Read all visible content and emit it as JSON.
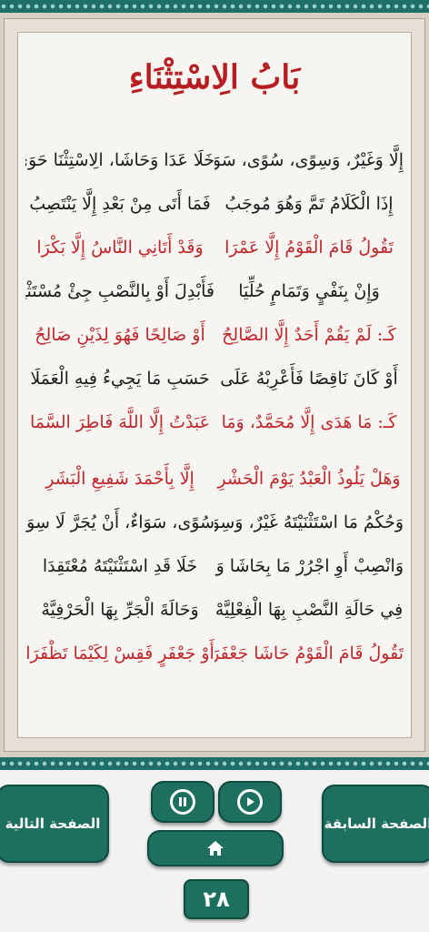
{
  "page": {
    "title": "بَابُ الِاسْتِثْنَاءِ",
    "verses": [
      {
        "right": "إِلَّا وَغَيْرٌ، وَسِوًى، سُوًى، سَوَا",
        "left": "خَلَا عَدَا وَحَاشَا، الِاسْتِثْنَا حَوَى",
        "color": "black"
      },
      {
        "right": "إِذَا الْكَلَامُ تَمَّ وَهُوَ مُوجَبُ",
        "left": "فَمَا أَتَى مِنْ بَعْدِ إِلَّا يَنْتَصِبُ",
        "color": "black"
      },
      {
        "right": "تَقُولُ قَامَ الْقَوْمُ إِلَّا عَمْرَا",
        "left": "وَقَدْ أَتَانِي النَّاسُ إِلَّا بَكْرَا",
        "color": "red"
      },
      {
        "right": "وَإِنْ بِنَفْيٍ وَتَمَامٍ حُلِّيَا",
        "left": "فَأَبْدِلَ أَوْ بِالنَّصْبِ جِئْ مُسْتَثْنِيَا",
        "color": "black"
      },
      {
        "right": "كَـ: لَمْ يَقُمْ أَحَدٌ إِلَّا الصَّالِحُ",
        "left": "أَوْ صَالِحًا فَهُوَ لِذَيْنِ صَالِحُ",
        "color": "red"
      },
      {
        "right": "أَوْ كَانَ نَاقِصًا فَأَعْرِبْهُ عَلَى",
        "left": "حَسَبِ مَا يَجِيءُ فِيهِ الْعَمَلَا",
        "color": "black"
      },
      {
        "right": "كَـ: مَا هَدَى إِلَّا مُحَمَّدٌ، وَمَا",
        "left": "عَبَدْتُ إِلَّا اللَّهَ فَاطِرَ السَّمَا",
        "color": "red"
      },
      {
        "right": "وَهَلْ يَلُوذُ الْعَبْدُ يَوْمَ الْحَشْرِ",
        "left": "إِلَّا بِأَحْمَدَ شَفِيعِ الْبَشَرِ",
        "color": "red"
      },
      {
        "right": "وَحُكْمُ مَا اسْتَثْنَيْتَهُ غَيْرٌ، وَسِوَى",
        "left": "سُوًى، سَوَاءٌ، أَنْ يُجَرَّ لَا سِوَى",
        "color": "black"
      },
      {
        "right": "وَانْصِبْ أَوِ اجْرُرْ مَا بِحَاشَا وَعَدَا",
        "left": "خَلَا قَدِ اسْتَثْنَيْتَهُ مُعْتَقِدَا",
        "color": "black"
      },
      {
        "right": "فِي حَالَةِ النَّصْبِ بِهَا الْفِعْلِيَّهْ",
        "left": "وَحَالَةَ الْجَرِّ بِهَا الْحَرْفِيَّهْ",
        "color": "black"
      },
      {
        "right": "تَقُولُ قَامَ الْقَوْمُ حَاشَا جَعْفَرَا",
        "left": "أَوْ جَعْفَرٍ فَقِسْ لِكَيْمَا تَظْفَرَا",
        "color": "red"
      }
    ]
  },
  "controls": {
    "next_label": "الصفحة التالية",
    "prev_label": "الصفحة السابقة",
    "pause_icon": "pause-icon",
    "play_icon": "play-icon",
    "home_icon": "home-icon",
    "page_number": "٢٨"
  },
  "colors": {
    "accent": "#1d6f5f",
    "title_red": "#b61e21",
    "verse_red": "#c0272d",
    "verse_black": "#1c1c1c"
  }
}
